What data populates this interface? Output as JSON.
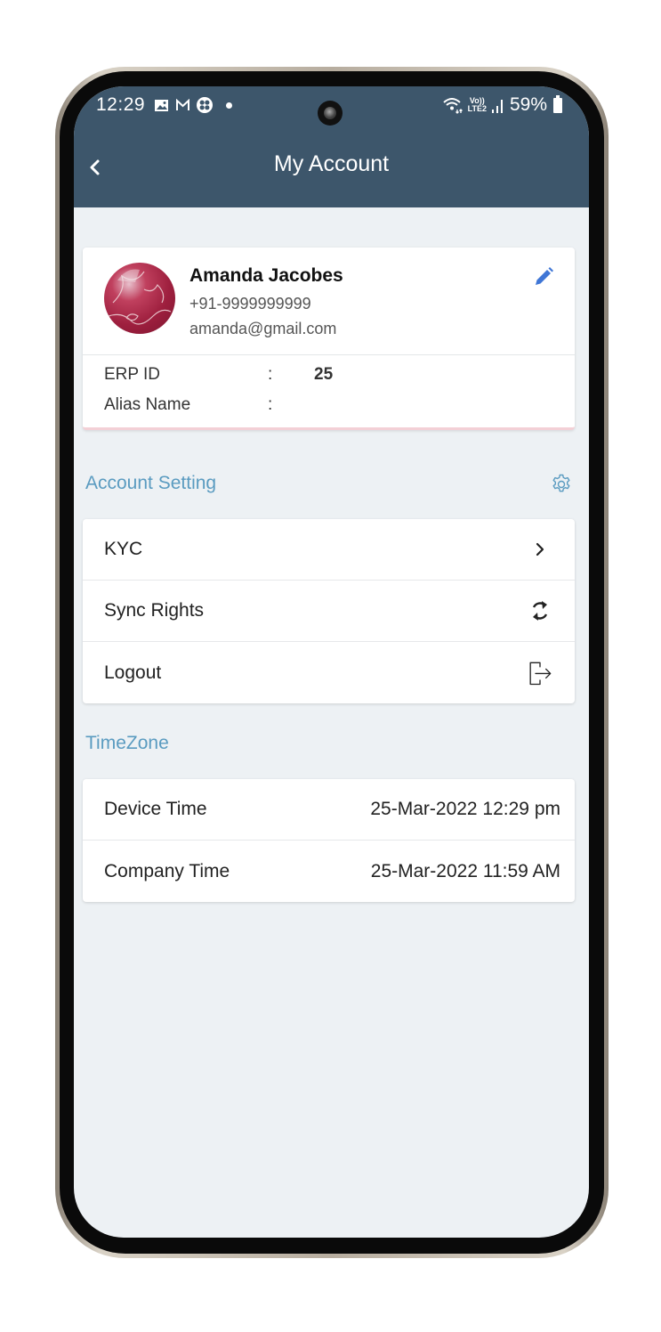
{
  "status_bar": {
    "time": "12:29",
    "notification_icons": [
      "gallery-icon",
      "gmail-icon",
      "app-icon",
      "dot-icon"
    ],
    "network_label_top": "Vo))",
    "network_label_bottom": "LTE2",
    "battery": "59%"
  },
  "header": {
    "title": "My Account",
    "back_icon": "chevron-left-icon"
  },
  "profile": {
    "name": "Amanda Jacobes",
    "phone": "+91-9999999999",
    "email": "amanda@gmail.com",
    "edit_icon": "pencil-icon",
    "fields": [
      {
        "label": "ERP ID",
        "separator": ":",
        "value": "25"
      },
      {
        "label": "Alias Name",
        "separator": ":",
        "value": ""
      }
    ]
  },
  "account_setting": {
    "title": "Account Setting",
    "icon": "gear-icon",
    "items": [
      {
        "label": "KYC",
        "icon": "chevron-right-icon"
      },
      {
        "label": "Sync Rights",
        "icon": "sync-icon"
      },
      {
        "label": "Logout",
        "icon": "logout-icon"
      }
    ]
  },
  "timezone": {
    "title": "TimeZone",
    "rows": [
      {
        "label": "Device Time",
        "value": "25-Mar-2022 12:29 pm"
      },
      {
        "label": "Company Time",
        "value": "25-Mar-2022 11:59 AM"
      }
    ]
  },
  "colors": {
    "header_bg": "#3d566b",
    "screen_bg": "#edf1f4",
    "section_title": "#5a9bc0",
    "edit_icon": "#3f76d6"
  }
}
